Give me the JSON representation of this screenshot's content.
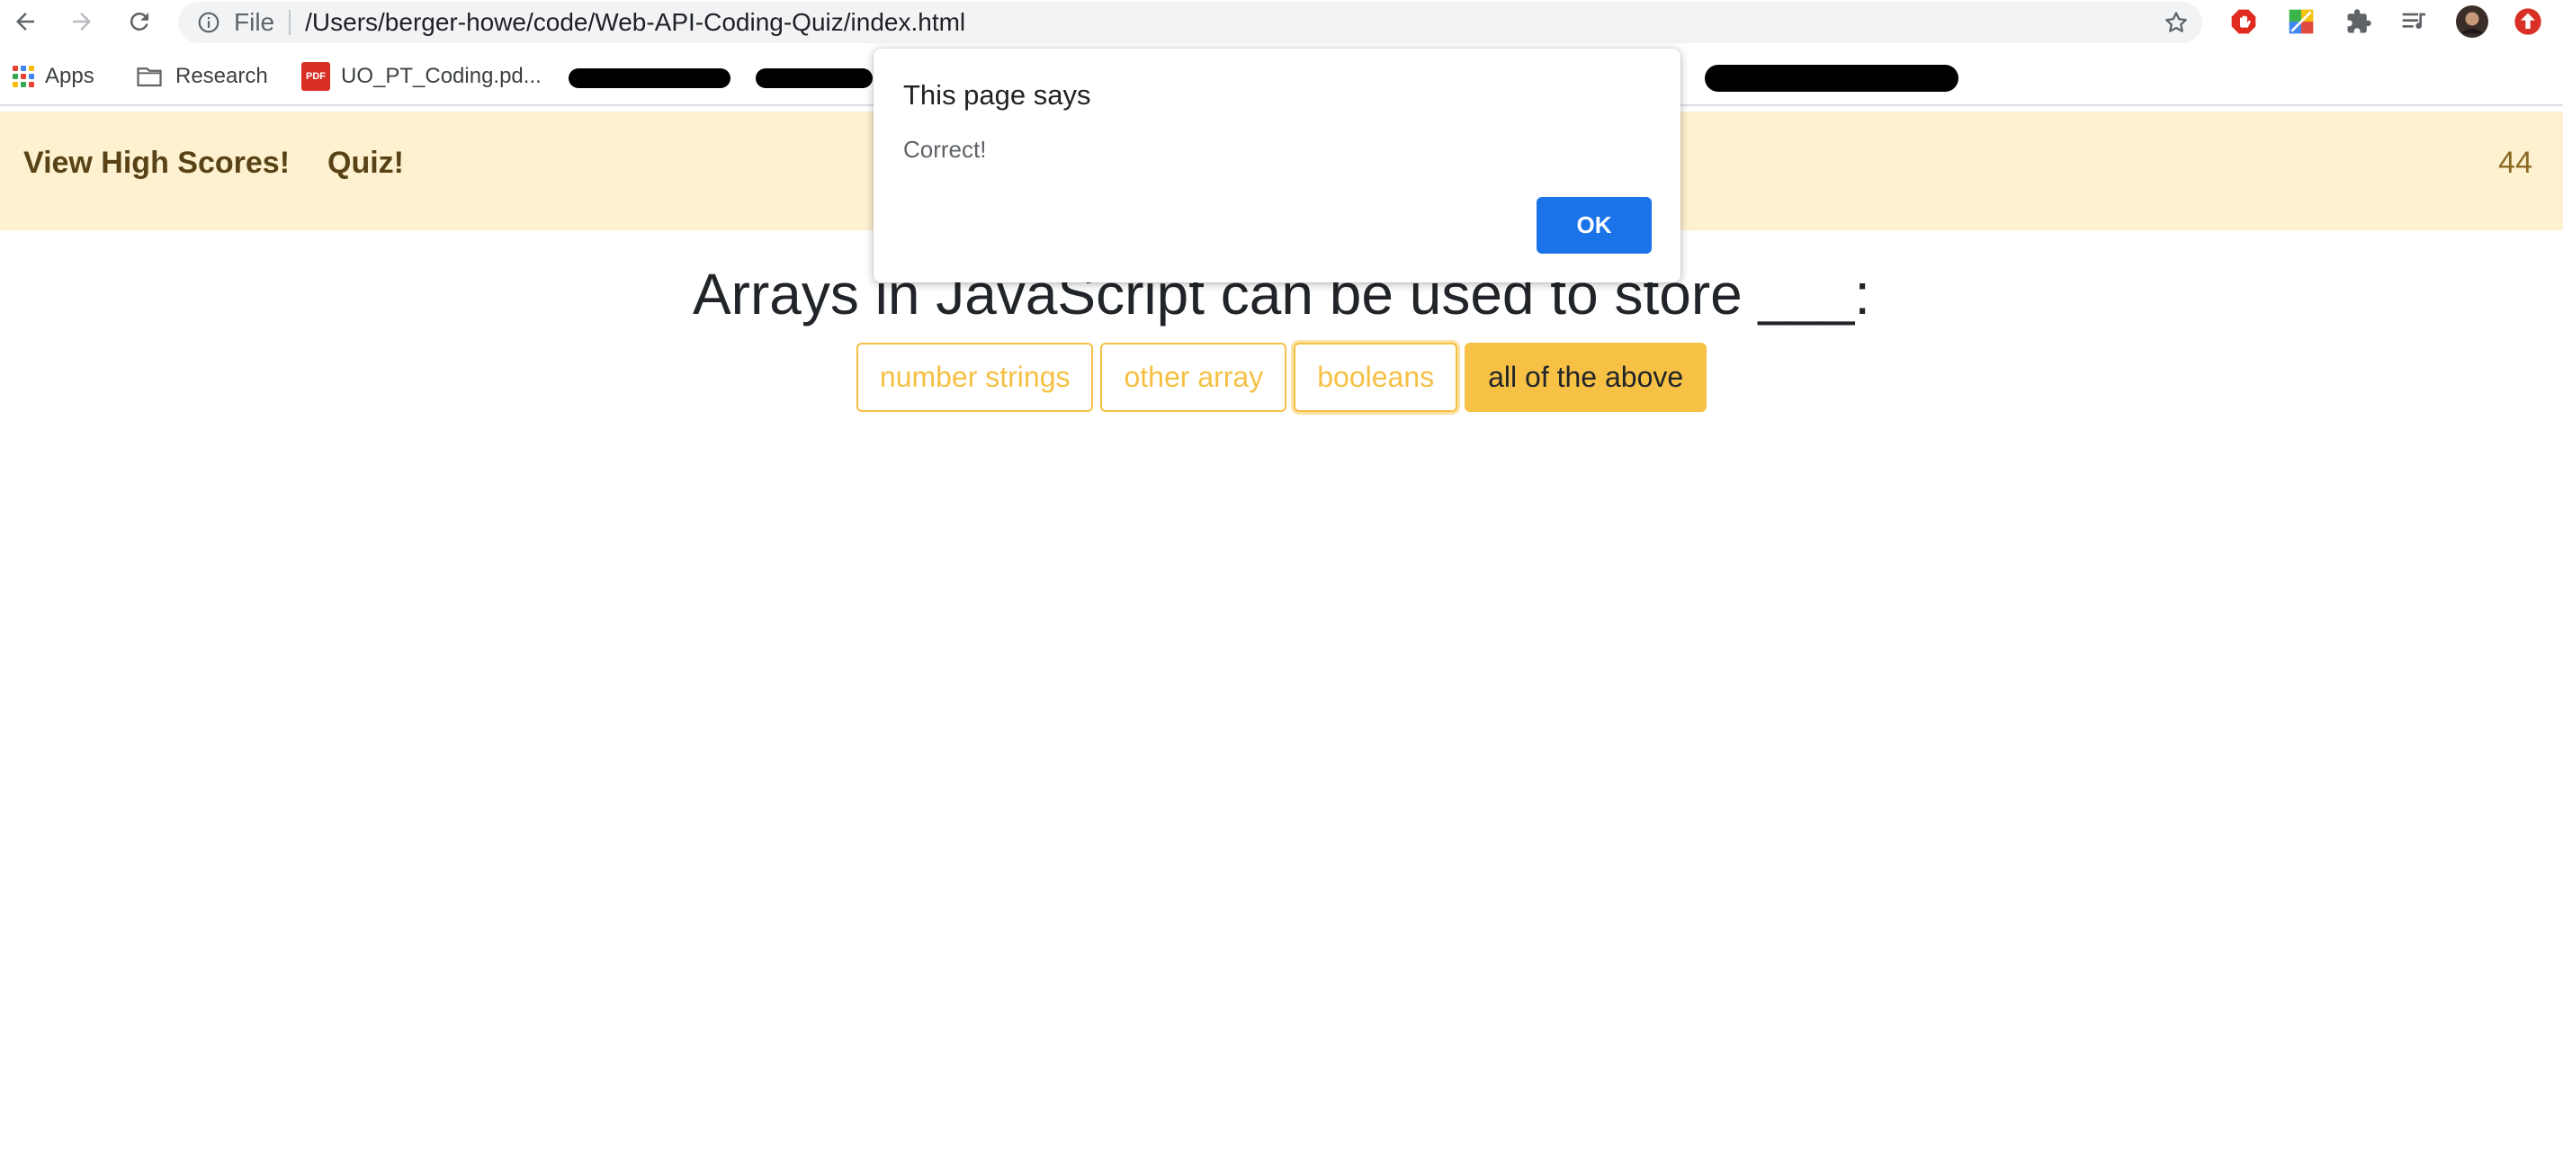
{
  "browser": {
    "scheme_label": "File",
    "url": "/Users/berger-howe/code/Web-API-Coding-Quiz/index.html",
    "bookmarks": {
      "apps": "Apps",
      "research": "Research",
      "pdf": "UO_PT_Coding.pd...",
      "pdf_badge": "PDF"
    },
    "icons": [
      "back-icon",
      "forward-icon",
      "reload-icon",
      "info-icon",
      "star-icon",
      "ad-block-icon",
      "extension-icon",
      "puzzle-icon",
      "reading-list-icon",
      "profile-avatar",
      "update-icon"
    ]
  },
  "page": {
    "nav": {
      "high_scores": "View High Scores!",
      "quiz": "Quiz!"
    },
    "timer": "44",
    "question": "Arrays in JavaScript can be used to store ___:",
    "answers": [
      {
        "label": "number strings"
      },
      {
        "label": "other array"
      },
      {
        "label": "booleans"
      },
      {
        "label": "all of the above"
      }
    ],
    "colors": {
      "accent": "#f6c044",
      "header_bg": "#fdf1cf",
      "dialog_button": "#1a73e8"
    }
  },
  "dialog": {
    "title": "This page says",
    "message": "Correct!",
    "ok_label": "OK"
  }
}
